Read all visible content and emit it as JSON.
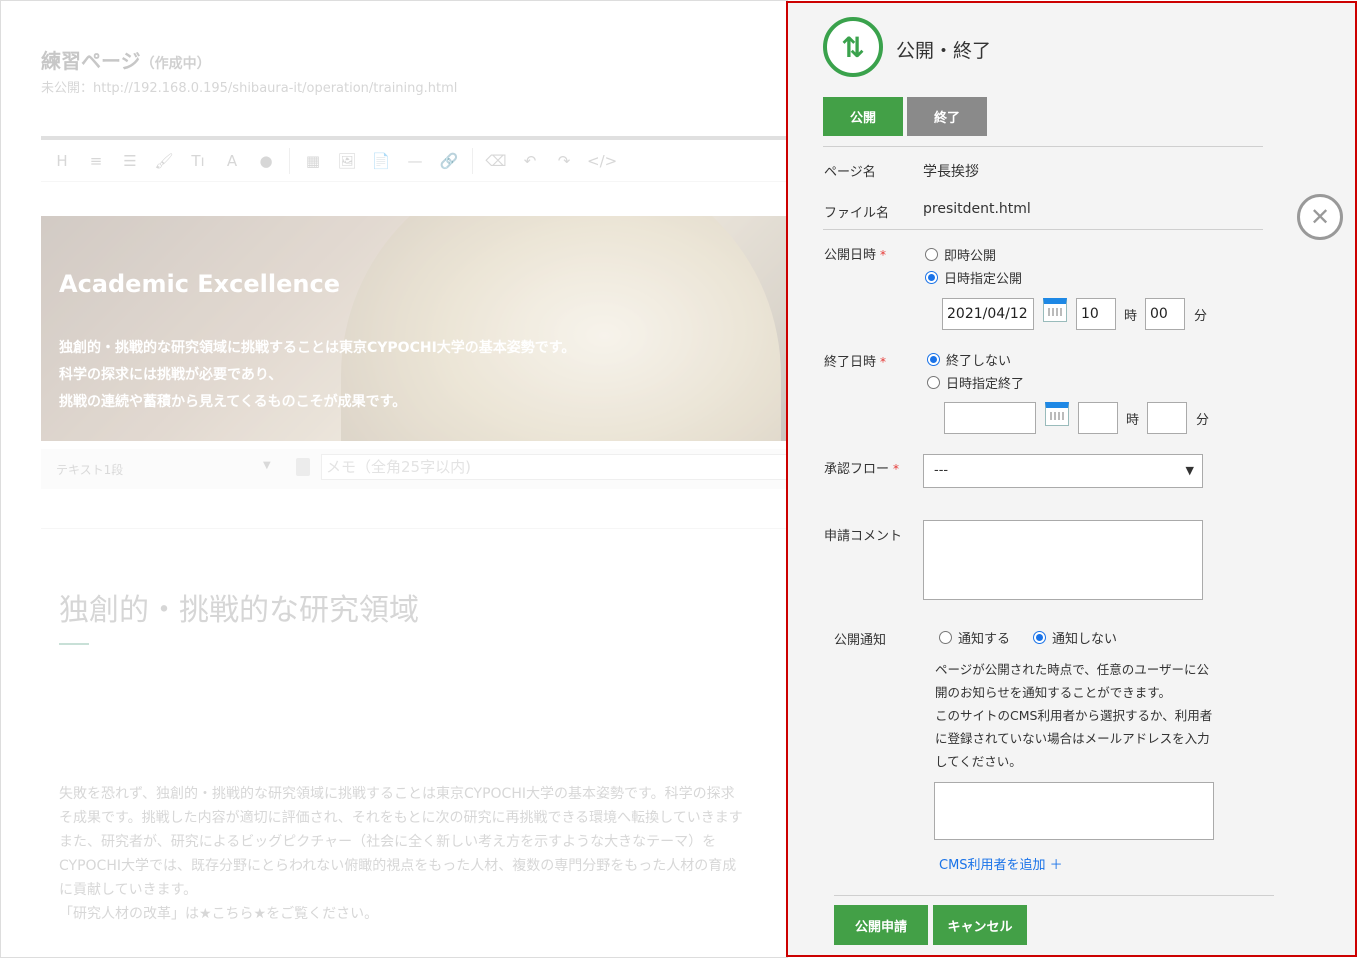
{
  "editor": {
    "page_title": "練習ページ",
    "page_status": "（作成中）",
    "page_url": "未公開：http://192.168.0.195/shibaura-it/operation/training.html",
    "toolbar": [
      "H",
      "≡",
      "☰",
      "🖌",
      "Tı",
      "A",
      "●",
      "▦",
      "🖼",
      "📄",
      "—",
      "🔗",
      "⌫",
      "↶",
      "↷",
      "</>"
    ],
    "hero": {
      "title": "Academic Excellence",
      "lines": [
        "独創的・挑戦的な研究領域に挑戦することは東京CYPOCHI大学の基本姿勢です。",
        "科学の探求には挑戦が必要であり、",
        "挑戦の連続や蓄積から見えてくるものこそが成果です。"
      ]
    },
    "block_type": "テキスト1段",
    "memo_placeholder": "メモ（全角25字以内)",
    "heading": "独創的・挑戦的な研究領域",
    "paragraph": [
      "失敗を恐れず、独創的・挑戦的な研究領域に挑戦することは東京CYPOCHI大学の基本姿勢です。科学の探求",
      "そ成果です。挑戦した内容が適切に評価され、それをもとに次の研究に再挑戦できる環境へ転換していきます",
      "また、研究者が、研究によるビッグピクチャー（社会に全く新しい考え方を示すような大きなテーマ）を",
      "CYPOCHI大学では、既存分野にとらわれない俯瞰的視点をもった人材、複数の専門分野をもった人材の育成",
      "に貢献していきます。",
      "「研究人材の改革」は★こちら★をご覧ください。"
    ]
  },
  "panel": {
    "title": "公開・終了",
    "tabs": {
      "open": "公開",
      "end": "終了"
    },
    "page_name_label": "ページ名",
    "page_name_value": "学長挨拶",
    "file_name_label": "ファイル名",
    "file_name_value": "presitdent.html",
    "publish_label": "公開日時",
    "publish_immediate": "即時公開",
    "publish_scheduled": "日時指定公開",
    "publish_date": "2021/04/12",
    "publish_hour": "10",
    "publish_min": "00",
    "hour_unit": "時",
    "min_unit": "分",
    "end_label": "終了日時",
    "end_none": "終了しない",
    "end_scheduled": "日時指定終了",
    "end_date": "",
    "end_hour": "",
    "end_min": "",
    "flow_label": "承認フロー",
    "flow_value": "---",
    "comment_label": "申請コメント",
    "notify_label": "公開通知",
    "notify_yes": "通知する",
    "notify_no": "通知しない",
    "help_lines": [
      "ページが公開された時点で、任意のユーザーに公",
      "開のお知らせを通知することができます。",
      "このサイトのCMS利用者から選択するか、利用者",
      "に登録されていない場合はメールアドレスを入力",
      "してください。"
    ],
    "add_user": "CMS利用者を追加 ＋",
    "apply_button": "公開申請",
    "cancel_button": "キャンセル",
    "required_mark": "*"
  },
  "close_icon_glyph": "✕",
  "colors": {
    "accent_green": "#43a047",
    "panel_border": "#cc0000",
    "link_blue": "#1a73e8"
  }
}
